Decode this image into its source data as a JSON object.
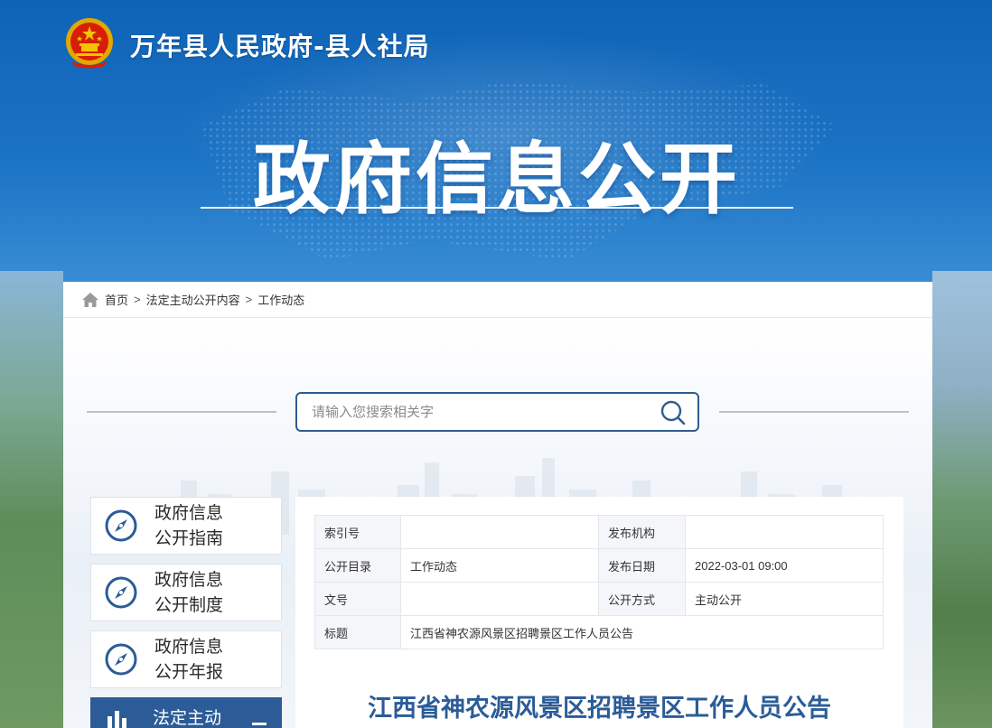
{
  "header": {
    "site_name": "万年县人民政府-县人社局",
    "hero_title": "政府信息公开"
  },
  "breadcrumb": {
    "items": [
      "首页",
      "法定主动公开内容",
      "工作动态"
    ],
    "separator": ">"
  },
  "search": {
    "placeholder": "请输入您搜索相关字"
  },
  "sidebar": {
    "items": [
      {
        "line1": "政府信息",
        "line2": "公开指南",
        "icon": "compass-icon"
      },
      {
        "line1": "政府信息",
        "line2": "公开制度",
        "icon": "compass-icon"
      },
      {
        "line1": "政府信息",
        "line2": "公开年报",
        "icon": "compass-icon"
      },
      {
        "line1": "法定主动",
        "icon": "chart-icon"
      }
    ]
  },
  "meta": {
    "index_label": "索引号",
    "index_value": "",
    "org_label": "发布机构",
    "org_value": "",
    "catalog_label": "公开目录",
    "catalog_value": "工作动态",
    "date_label": "发布日期",
    "date_value": "2022-03-01 09:00",
    "doc_label": "文号",
    "doc_value": "",
    "mode_label": "公开方式",
    "mode_value": "主动公开",
    "title_label": "标题",
    "title_value": "江西省神农源风景区招聘景区工作人员公告"
  },
  "article": {
    "title": "江西省神农源风景区招聘景区工作人员公告"
  },
  "colors": {
    "primary": "#2b5c97",
    "emblem_red": "#d81e06",
    "emblem_gold": "#f5c400"
  }
}
